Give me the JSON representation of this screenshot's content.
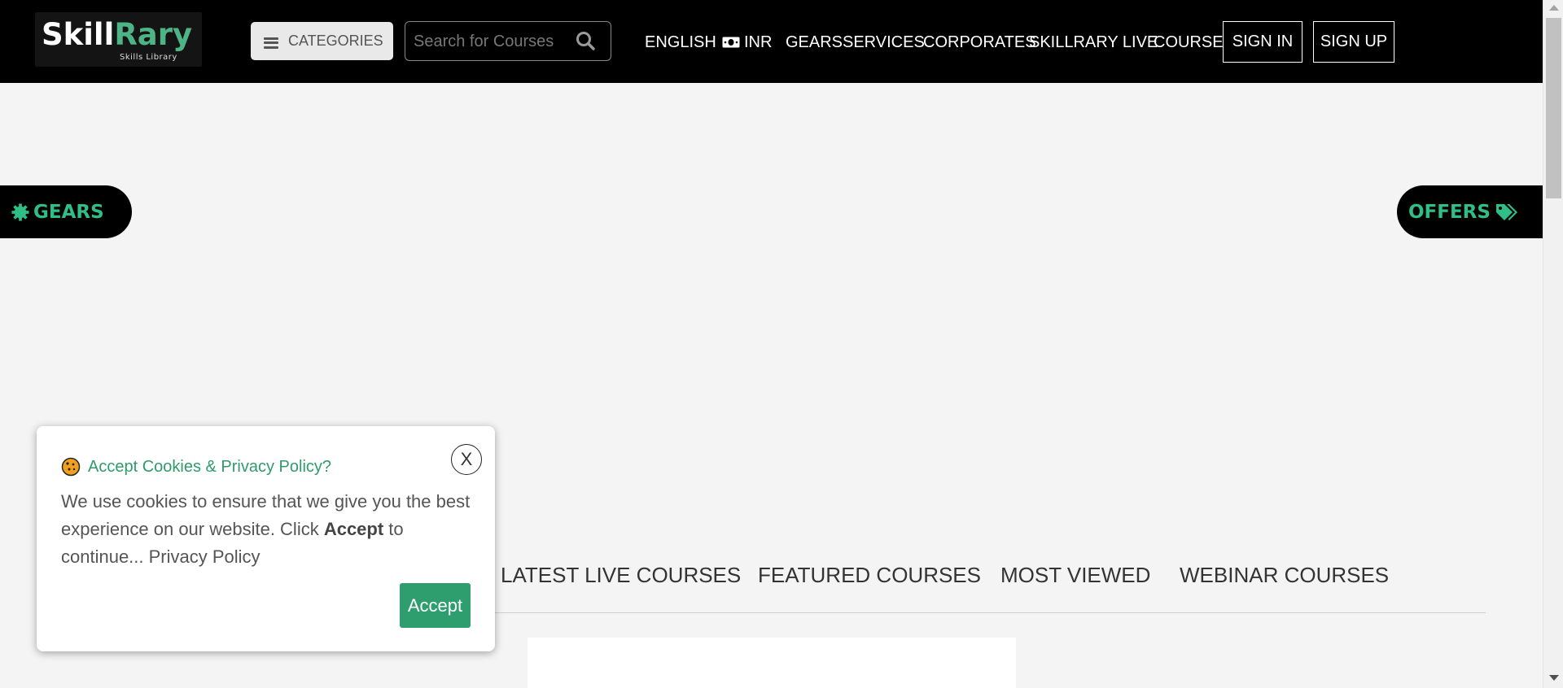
{
  "header": {
    "logo": {
      "main_white": "Skill",
      "main_green": "Rary",
      "sub": "Skills Library"
    },
    "categories_label": "CATEGORIES",
    "search_placeholder": "Search for Courses",
    "nav": {
      "english": "ENGLISH",
      "inr": "INR",
      "gears": "GEARS",
      "services": "SERVICES",
      "corporates": "CORPORATES",
      "skillrary_live": "SKILLRARY LIVE",
      "course": "COURSE"
    },
    "sign_in": "SIGN IN",
    "sign_up": "SIGN UP"
  },
  "side": {
    "gears": "GEARS",
    "offers": "OFFERS"
  },
  "tabs": [
    {
      "label": "LATEST LIVE COURSES"
    },
    {
      "label": "FEATURED COURSES"
    },
    {
      "label": "MOST VIEWED"
    },
    {
      "label": "WEBINAR COURSES"
    }
  ],
  "cookie": {
    "close": "X",
    "title": "Accept Cookies & Privacy Policy?",
    "text_before": "We use cookies to ensure that we give you the best experience on our website. Click ",
    "text_bold": "Accept",
    "text_after": " to continue... Privacy Policy",
    "accept_label": "Accept"
  },
  "colors": {
    "header_bg": "#000000",
    "brand_green": "#2fbf86",
    "accept_green": "#2e9e6e",
    "page_bg": "#f4f4f4"
  }
}
